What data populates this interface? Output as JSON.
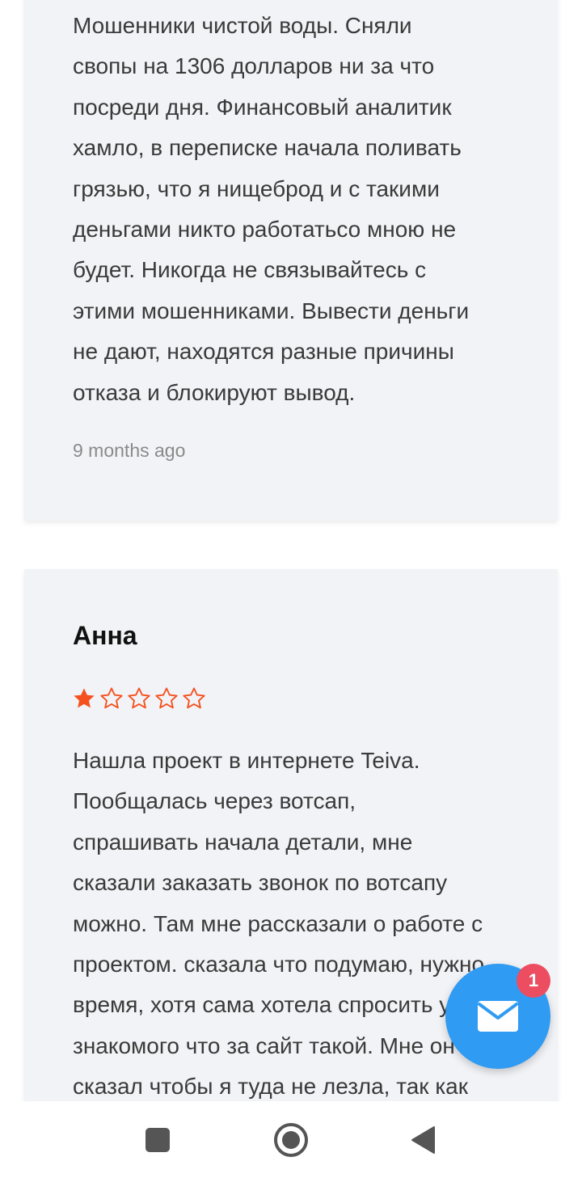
{
  "reviews": [
    {
      "text": "Мошенники чистой воды. Сняли\nсвопы на 1306 долларов ни за что\nпосреди дня. Финансовый аналитик\nхамло, в переписке начала поливать\nгрязью, что я нищеброд и с такими\nденьгами никто работатьсо мною не\nбудет. Никогда не связывайтесь с\nэтими мошенниками. Вывести деньги\nне дают, находятся разные причины\nотказа и блокируют вывод.",
      "time": "9 months ago"
    },
    {
      "author": "Анна",
      "rating": 1,
      "rating_max": 5,
      "text": "Нашла проект в интернете Teiva.\nПообщалась через вотсап,\nспрашивать начала детали, мне\nсказали заказать звонок по вотсапу\nможно. Там мне рассказали о работе с\nпроектом. сказала что подумаю, нужно\nвремя, хотя сама хотела спросить у\nзнакомого что за сайт такой. Мне он\nсказал чтобы я туда не лезла, так как"
    }
  ],
  "chat_widget": {
    "icon": "mail-icon",
    "badge_count": "1",
    "color": "#2f9bf2",
    "badge_color": "#ec4d61"
  },
  "colors": {
    "star": "#f4511e",
    "card_bg": "#f2f3f7"
  },
  "navigation": {
    "icons": [
      "recent-apps-icon",
      "home-icon",
      "back-icon"
    ]
  }
}
